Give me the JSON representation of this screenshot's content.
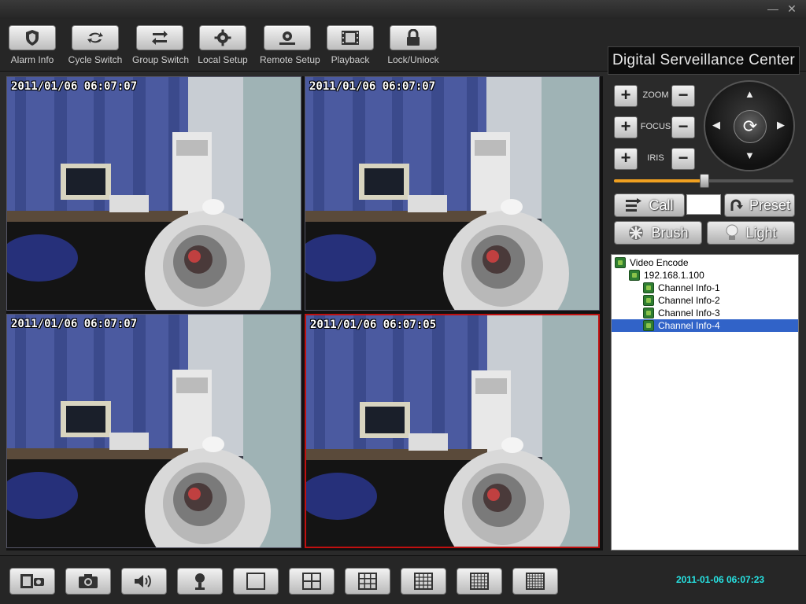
{
  "window": {
    "minimize_icon": "minimize-icon",
    "close_icon": "close-icon",
    "minimize_glyph": "—",
    "close_glyph": "✕"
  },
  "toolbar": {
    "items": [
      {
        "label": "Alarm Info",
        "icon": "shield-icon"
      },
      {
        "label": "Cycle Switch",
        "icon": "cycle-icon"
      },
      {
        "label": "Group Switch",
        "icon": "group-switch-icon"
      },
      {
        "label": "Local Setup",
        "icon": "gear-icon"
      },
      {
        "label": "Remote Setup",
        "icon": "remote-gear-icon"
      },
      {
        "label": "Playback",
        "icon": "film-icon"
      },
      {
        "label": "Lock/Unlock",
        "icon": "lock-icon"
      }
    ],
    "brand": "Digital Serveillance Center"
  },
  "video": {
    "panes": [
      {
        "timestamp": "2011/01/06 06:07:07",
        "active": false
      },
      {
        "timestamp": "2011/01/06 06:07:07",
        "active": false
      },
      {
        "timestamp": "2011/01/06 06:07:07",
        "active": false
      },
      {
        "timestamp": "2011/01/06 06:07:05",
        "active": true
      }
    ],
    "active_border_color": "#c01010"
  },
  "ptz": {
    "zoom_label": "ZOOM",
    "focus_label": "FOCUS",
    "iris_label": "IRIS",
    "plus": "+",
    "minus": "−",
    "up": "▲",
    "down": "▼",
    "left": "◀",
    "right": "▶",
    "center": "⟳",
    "speed_fraction": 0.5,
    "slider_color": "#f0a020",
    "call_label": "Call",
    "preset_label": "Preset",
    "brush_label": "Brush",
    "light_label": "Light"
  },
  "tree": {
    "root": "Video Encode",
    "device": "192.168.1.100",
    "channels": [
      "Channel Info-1",
      "Channel Info-2",
      "Channel Info-3",
      "Channel Info-4"
    ],
    "selected_index": 3,
    "selection_color": "#3163c8"
  },
  "bottom": {
    "buttons": [
      {
        "icon": "record-icon"
      },
      {
        "icon": "camera-icon"
      },
      {
        "icon": "speaker-icon"
      },
      {
        "icon": "talk-icon"
      },
      {
        "icon": "layout-1-icon"
      },
      {
        "icon": "layout-4-icon"
      },
      {
        "icon": "layout-9-icon"
      },
      {
        "icon": "layout-16-icon"
      },
      {
        "icon": "layout-25-icon"
      },
      {
        "icon": "layout-36-icon"
      }
    ],
    "clock": "2011-01-06 06:07:23",
    "clock_color": "#27e3e3"
  }
}
